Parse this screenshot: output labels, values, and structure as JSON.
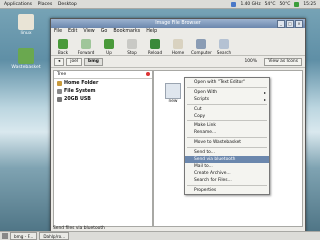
{
  "top_panel": {
    "menus": [
      "Applications",
      "Places",
      "Desktop"
    ],
    "tray": [
      {
        "label": "1.40 GHz"
      },
      {
        "label": "54°C"
      },
      {
        "label": "50°C"
      },
      {
        "label": "15:25"
      }
    ]
  },
  "desktop_icons": [
    {
      "label": "linux"
    },
    {
      "label": "Wastebasket"
    }
  ],
  "window": {
    "title": "Image File Browser",
    "menu": [
      "File",
      "Edit",
      "View",
      "Go",
      "Bookmarks",
      "Help"
    ],
    "toolbar": [
      "Back",
      "Forward",
      "Up",
      "Stop",
      "Reload",
      "Home",
      "Computer",
      "Search"
    ],
    "breadcrumbs": [
      "joel",
      "bmg"
    ],
    "zoom": "100%",
    "view_mode": "View as Icons",
    "sidebar": {
      "header": "Tree",
      "items": [
        "Home Folder",
        "File System",
        "20GB USB"
      ]
    },
    "content_files": [
      {
        "label": "new"
      }
    ],
    "status": "Send files via bluetooth"
  },
  "context_menu": [
    {
      "label": "Open with \"Text Editor\""
    },
    {
      "sep": true
    },
    {
      "label": "Open With",
      "sub": true
    },
    {
      "label": "Scripts",
      "sub": true
    },
    {
      "sep": true
    },
    {
      "label": "Cut"
    },
    {
      "label": "Copy"
    },
    {
      "sep": true
    },
    {
      "label": "Make Link"
    },
    {
      "label": "Rename..."
    },
    {
      "sep": true
    },
    {
      "label": "Move to Wastebasket"
    },
    {
      "sep": true
    },
    {
      "label": "Send to..."
    },
    {
      "label": "Send via bluetooth",
      "highlight": true
    },
    {
      "label": "Mail to..."
    },
    {
      "label": "Create Archive..."
    },
    {
      "label": "Search for Files..."
    },
    {
      "sep": true
    },
    {
      "label": "Properties"
    }
  ],
  "taskbar": [
    {
      "label": "bmg - F..."
    },
    {
      "label": "Dahlp/ro..."
    }
  ],
  "colors": {
    "accent": "#6b87ad"
  }
}
